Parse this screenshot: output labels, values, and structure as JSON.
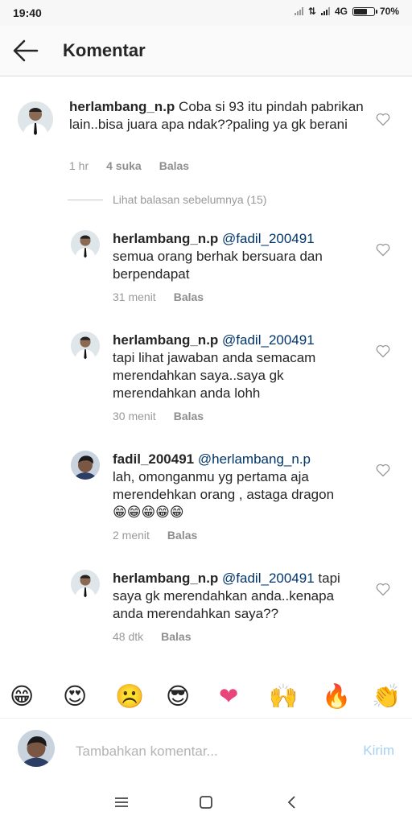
{
  "status_bar": {
    "time": "19:40",
    "network": "4G",
    "battery": "70%",
    "battery_level": 0.7
  },
  "header": {
    "title": "Komentar"
  },
  "comments": [
    {
      "username": "herlambang_n.p",
      "mention": "",
      "text": "Coba si 93 itu pindah pabrikan lain..bisa juara apa ndak??paling ya gk berani",
      "time": "1 hr",
      "likes": "4 suka",
      "reply": "Balas"
    },
    {
      "username": "herlambang_n.p",
      "mention": "@fadil_200491",
      "text": "semua orang berhak bersuara dan berpendapat",
      "time": "31 menit",
      "likes": "",
      "reply": "Balas"
    },
    {
      "username": "herlambang_n.p",
      "mention": "@fadil_200491",
      "text": "tapi lihat jawaban anda semacam merendahkan saya..saya gk merendahkan anda lohh",
      "time": "30 menit",
      "likes": "",
      "reply": "Balas"
    },
    {
      "username": "fadil_200491",
      "mention": "@herlambang_n.p",
      "text": "lah, omonganmu yg pertama aja merendehkan orang , astaga dragon",
      "emoji": "😁😁😁😁😁",
      "time": "2 menit",
      "likes": "",
      "reply": "Balas"
    },
    {
      "username": "herlambang_n.p",
      "mention": "@fadil_200491",
      "text": "tapi saya gk merendahkan anda..kenapa anda merendahkan saya??",
      "time": "48 dtk",
      "likes": "",
      "reply": "Balas"
    }
  ],
  "view_previous": "Lihat balasan sebelumnya (15)",
  "emoji_bar": [
    {
      "name": "grin",
      "char": "😁"
    },
    {
      "name": "heart-eyes",
      "char": "😍"
    },
    {
      "name": "frown",
      "char": "☹️"
    },
    {
      "name": "sunglasses",
      "char": "😎"
    },
    {
      "name": "heart",
      "char": "❤"
    },
    {
      "name": "raised-hands",
      "char": "🙌"
    },
    {
      "name": "fire",
      "char": "🔥"
    },
    {
      "name": "clap",
      "char": "👏"
    }
  ],
  "input": {
    "placeholder": "Tambahkan komentar...",
    "send_label": "Kirim"
  },
  "colors": {
    "mention": "#003569",
    "send_disabled": "#a8d1f2",
    "meta": "#999999"
  },
  "icons": {
    "back": "arrow-left-icon",
    "like": "heart-outline-icon",
    "nav": [
      "menu-icon",
      "home-square-icon",
      "back-triangle-icon"
    ]
  }
}
